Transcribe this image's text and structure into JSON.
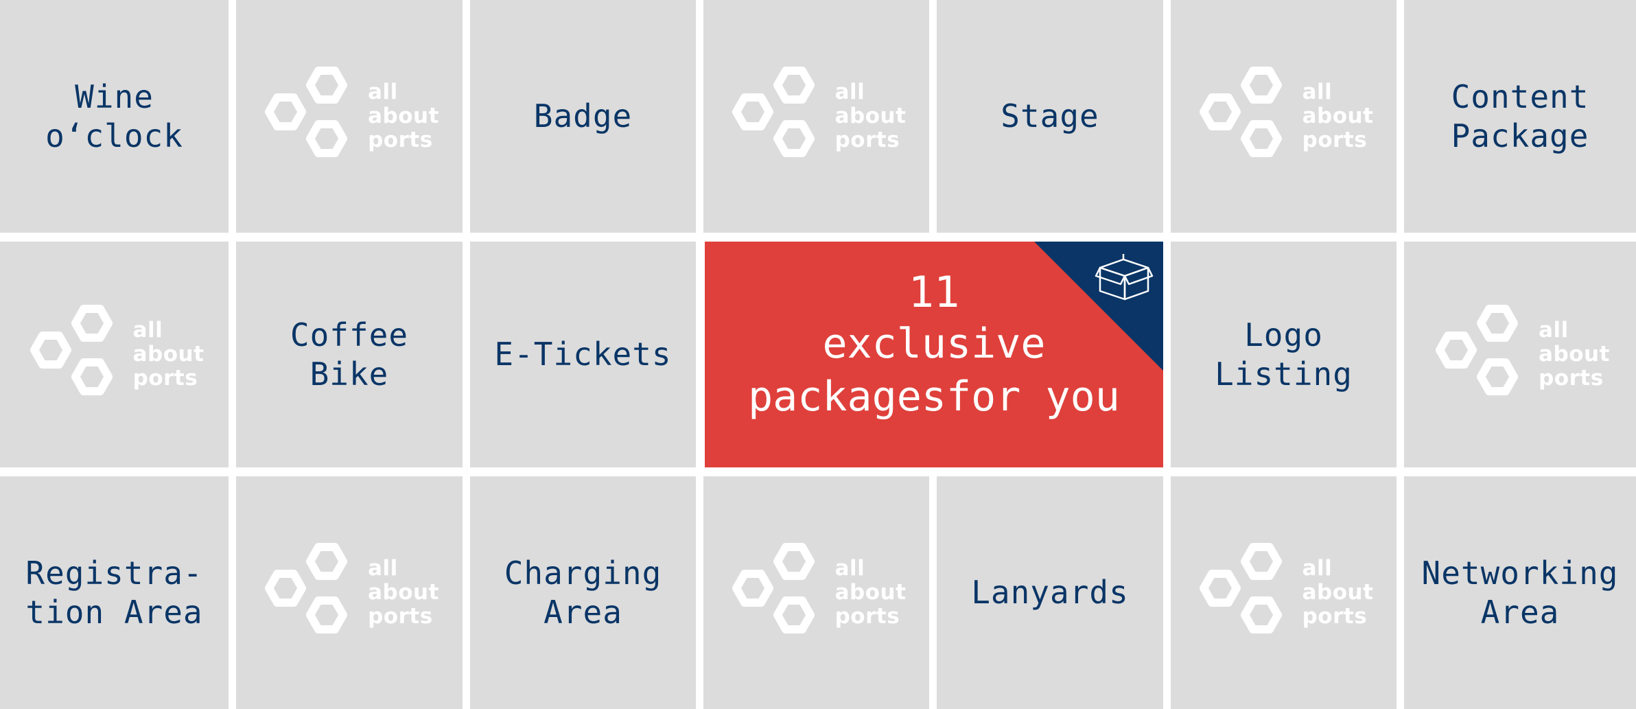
{
  "colors": {
    "tile_background": "#dcdcdc",
    "label_text": "#0a3566",
    "hero_background": "#df403b",
    "hero_corner": "#0a3566",
    "logo": "#ffffff"
  },
  "logo": {
    "icon": "hexagon-cluster-icon",
    "lines": [
      "all",
      "about",
      "ports"
    ]
  },
  "hero": {
    "count": "11",
    "line1": "exclusive",
    "line2": "packagesfor you",
    "icon": "package-box-icon"
  },
  "tiles": {
    "wine_oclock": "Wine\no‘clock",
    "badge": "Badge",
    "stage": "Stage",
    "content_package": "Content\nPackage",
    "coffee_bike": "Coffee\nBike",
    "e_tickets": "E-Tickets",
    "logo_listing": "Logo\nListing",
    "registration_area": "Registra-\ntion Area",
    "charging_area": "Charging\nArea",
    "lanyards": "Lanyards",
    "networking_area": "Networking\nArea"
  }
}
